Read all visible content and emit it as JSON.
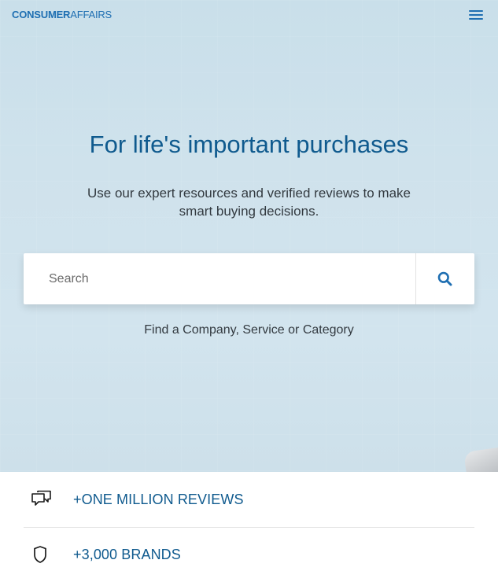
{
  "header": {
    "logo_bold": "CONSUMER",
    "logo_light": "AFFAIRS",
    "menu_icon": "hamburger-menu-icon"
  },
  "hero": {
    "title": "For life's important purchases",
    "subtitle": "Use our expert resources and verified reviews to make smart buying decisions.",
    "search": {
      "placeholder": "Search",
      "value": "",
      "button_icon": "search-icon"
    },
    "helper_text": "Find a Company, Service or Category"
  },
  "stats": [
    {
      "icon": "chat-bubbles-icon",
      "label": "+ONE MILLION REVIEWS"
    },
    {
      "icon": "shield-icon",
      "label": "+3,000 BRANDS"
    }
  ],
  "colors": {
    "brand_blue": "#1f6fb2",
    "heading_blue": "#0f5a8e",
    "hero_background": "#cfe2ec",
    "body_text": "#333a40"
  }
}
